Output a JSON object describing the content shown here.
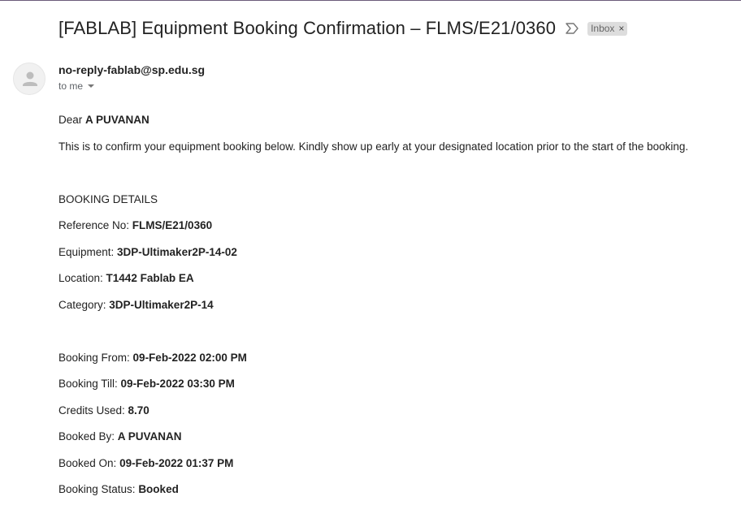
{
  "email": {
    "subject": "[FABLAB] Equipment Booking Confirmation – FLMS/E21/0360",
    "label": "Inbox",
    "label_close": "×",
    "sender": "no-reply-fablab@sp.edu.sg",
    "recipient": "to me",
    "greeting_prefix": "Dear ",
    "greeting_name": "A PUVANAN",
    "intro": "This is to confirm your equipment booking below. Kindly show up early at your designated location prior to the start of the booking.",
    "section_heading": "BOOKING DETAILS",
    "details": [
      {
        "label": "Reference No: ",
        "value": "FLMS/E21/0360"
      },
      {
        "label": "Equipment: ",
        "value": "3DP-Ultimaker2P-14-02"
      },
      {
        "label": "Location: ",
        "value": "T1442 Fablab EA"
      },
      {
        "label": "Category: ",
        "value": "3DP-Ultimaker2P-14"
      }
    ],
    "booking": [
      {
        "label": "Booking From: ",
        "value": "09-Feb-2022 02:00 PM"
      },
      {
        "label": "Booking Till: ",
        "value": "09-Feb-2022 03:30 PM"
      },
      {
        "label": "Credits Used: ",
        "value": "8.70"
      },
      {
        "label": "Booked By: ",
        "value": "A PUVANAN"
      },
      {
        "label": "Booked On: ",
        "value": "09-Feb-2022 01:37 PM"
      },
      {
        "label": "Booking Status: ",
        "value": "Booked"
      }
    ]
  },
  "icons": {
    "importance": "importance-marker-icon",
    "avatar": "person-avatar-icon",
    "caret": "chevron-down-icon"
  }
}
